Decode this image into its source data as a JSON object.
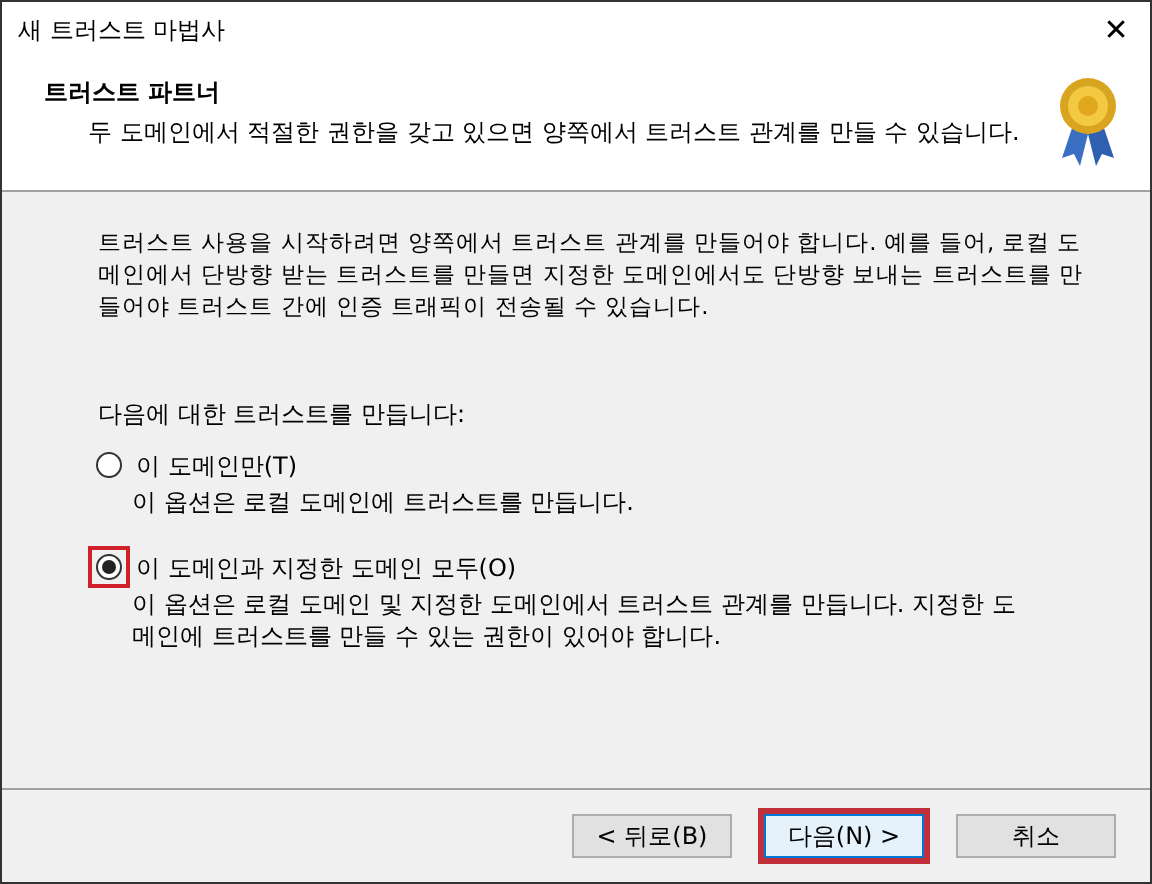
{
  "window": {
    "title": "새 트러스트 마법사",
    "close": "✕"
  },
  "header": {
    "title": "트러스트 파트너",
    "subtitle": "두 도메인에서 적절한 권한을 갖고 있으면 양쪽에서 트러스트 관계를 만들 수 있습니다."
  },
  "intro": "트러스트 사용을 시작하려면 양쪽에서 트러스트 관계를 만들어야 합니다. 예를 들어, 로컬 도메인에서 단방향 받는 트러스트를 만들면 지정한 도메인에서도 단방향 보내는 트러스트를 만들어야 트러스트 간에 인증 트래픽이 전송될 수 있습니다.",
  "prompt": "다음에 대한 트러스트를 만듭니다:",
  "options": [
    {
      "label": "이 도메인만(T)",
      "description": "이 옵션은 로컬 도메인에 트러스트를 만듭니다.",
      "selected": false,
      "highlighted": false
    },
    {
      "label": "이 도메인과 지정한 도메인 모두(O)",
      "description": "이 옵션은 로컬 도메인 및 지정한 도메인에서 트러스트 관계를 만듭니다. 지정한 도메인에 트러스트를 만들 수 있는 권한이 있어야 합니다.",
      "selected": true,
      "highlighted": true
    }
  ],
  "buttons": [
    {
      "label": "< 뒤로(B)",
      "default": false,
      "highlighted": false
    },
    {
      "label": "다음(N) >",
      "default": true,
      "highlighted": true
    },
    {
      "label": "취소",
      "default": false,
      "highlighted": false
    }
  ]
}
